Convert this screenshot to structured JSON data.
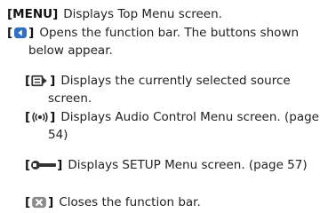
{
  "entries": [
    {
      "key": "[MENU]",
      "text": "Displays Top Menu screen."
    },
    {
      "icon": "back-arrow-icon",
      "text": "Opens the function bar. The buttons shown below appear."
    },
    {
      "icon": "source-display-icon",
      "text": "Displays the currently selected source screen."
    },
    {
      "icon": "audio-control-icon",
      "text": "Displays Audio Control Menu screen. (page 54)"
    },
    {
      "icon": "setup-wrench-icon",
      "text": "Displays SETUP Menu screen. (page 57)"
    },
    {
      "icon": "close-x-icon",
      "text": "Closes the function bar."
    }
  ],
  "brackets": {
    "open": "[",
    "close": "]"
  },
  "colors": {
    "icon_blue": "#2f6fc4",
    "icon_dark": "#333333",
    "icon_grey": "#8a8a8a"
  }
}
